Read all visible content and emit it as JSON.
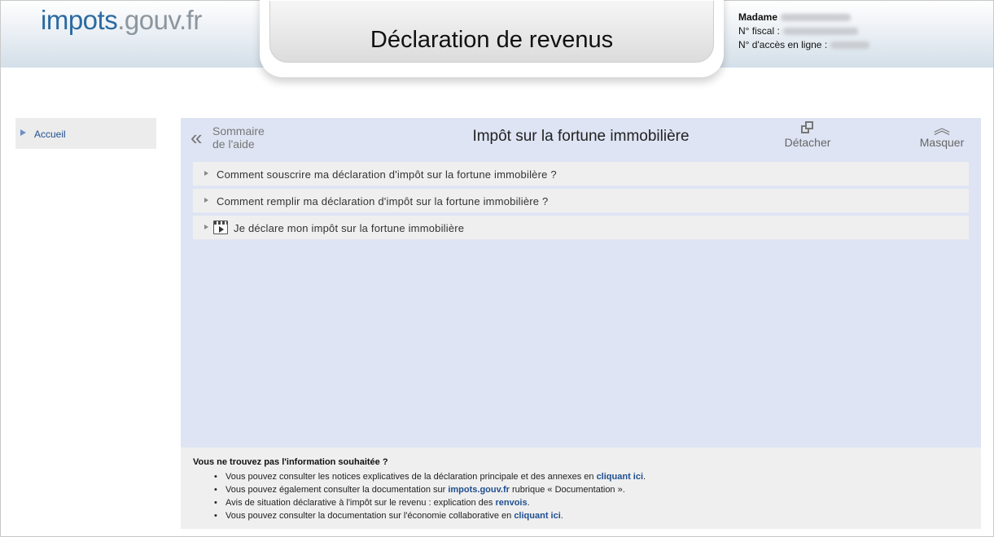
{
  "header": {
    "logo_part1": "impots",
    "logo_part2": ".gouv.fr",
    "title": "Déclaration de revenus",
    "user_title": "Madame",
    "fiscal_label": "N° fiscal :",
    "access_label": "N° d'accès en ligne :"
  },
  "sidebar": {
    "items": [
      {
        "label": "Accueil"
      }
    ]
  },
  "help": {
    "back_label_line1": "Sommaire",
    "back_label_line2": "de l'aide",
    "title": "Impôt sur la fortune immobilière",
    "detach_label": "Détacher",
    "hide_label": "Masquer",
    "items": [
      {
        "label": "Comment souscrire ma déclaration d'impôt sur la fortune immobilère ?",
        "icon": "none"
      },
      {
        "label": "Comment remplir ma déclaration d'impôt sur la fortune immobilière ?",
        "icon": "none"
      },
      {
        "label": "Je déclare mon impôt sur la fortune immobilière",
        "icon": "video-icon"
      }
    ]
  },
  "footer": {
    "question": "Vous ne trouvez pas l'information souhaitée ?",
    "items": [
      {
        "text": "Vous pouvez consulter les notices explicatives de la déclaration principale et des annexes en ",
        "link": "cliquant ici",
        "after": "."
      },
      {
        "text": "Vous pouvez également consulter la documentation sur ",
        "link": "impots.gouv.fr",
        "after": " rubrique « Documentation »."
      },
      {
        "text": "Avis de situation déclarative à l'impôt sur le revenu : explication des ",
        "link": "renvois",
        "after": "."
      },
      {
        "text": "Vous pouvez consulter la documentation sur l'économie collaborative en ",
        "link": "cliquant ici",
        "after": "."
      }
    ]
  },
  "colors": {
    "accent": "#2b6aa1",
    "panel_bg": "#dee4f3",
    "link": "#1f4f8f"
  }
}
